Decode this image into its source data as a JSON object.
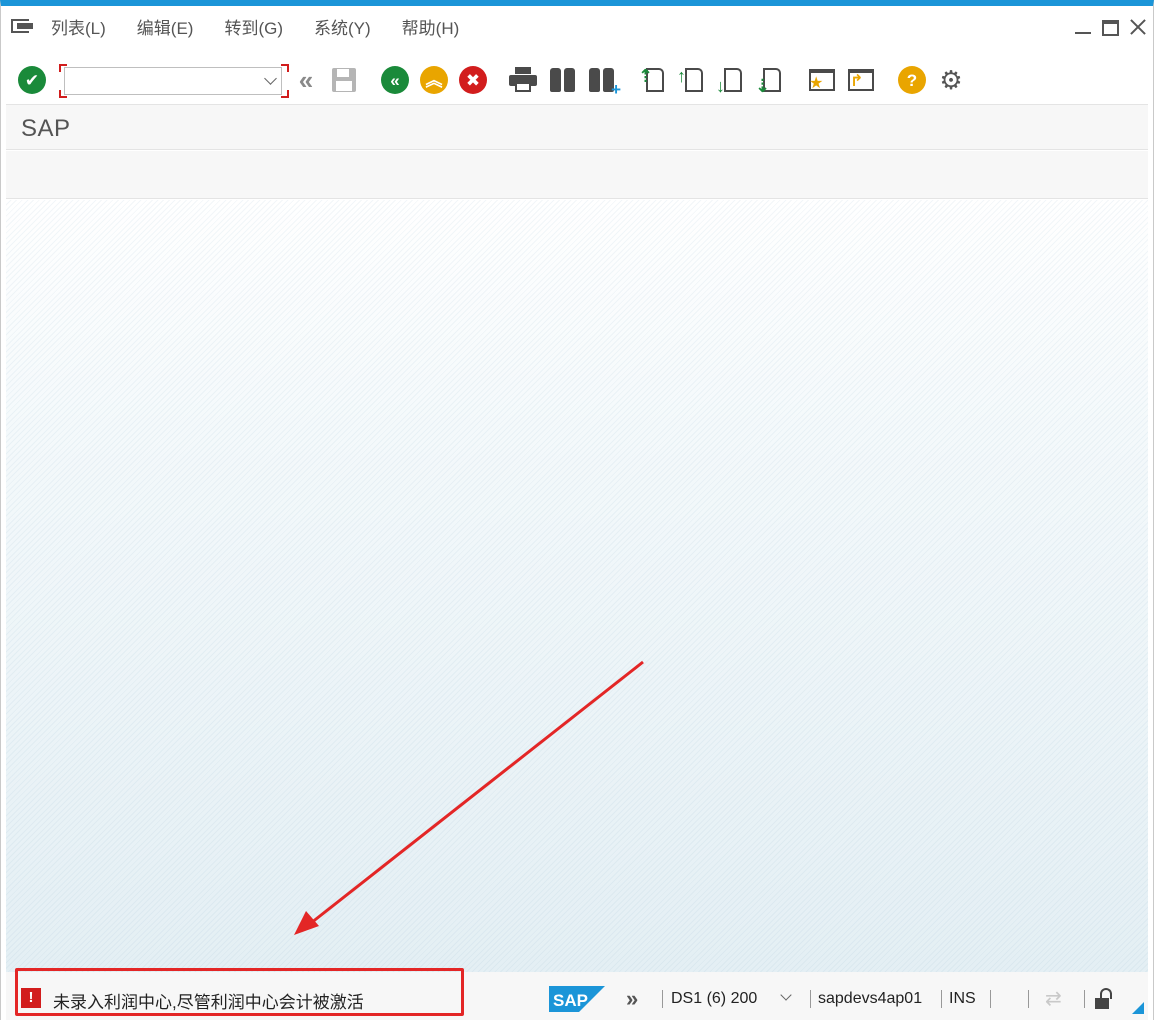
{
  "menubar": {
    "items": [
      "列表(L)",
      "编辑(E)",
      "转到(G)",
      "系统(Y)",
      "帮助(H)"
    ]
  },
  "toolbar": {
    "command_field": {
      "value": "",
      "placeholder": ""
    }
  },
  "title": "SAP",
  "status": {
    "type": "error",
    "error_symbol": "!",
    "message": "未录入利润中心,尽管利润中心会计被激活",
    "system_more": "»",
    "system": "DS1 (6) 200",
    "server": "sapdevs4ap01",
    "mode": "INS"
  },
  "colors": {
    "accent": "#1b95d8",
    "error": "#d21d1d",
    "annotation": "#e32626",
    "ok_green": "#1a8a3a",
    "up_yellow": "#e9a500"
  },
  "icons": {
    "toolbar": [
      "enter-check-icon",
      "back-double-chevron-icon",
      "save-icon",
      "back-icon",
      "exit-icon",
      "cancel-icon",
      "print-icon",
      "find-icon",
      "find-next-icon",
      "first-page-icon",
      "previous-page-icon",
      "next-page-icon",
      "last-page-icon",
      "create-session-icon",
      "generate-shortcut-icon",
      "help-icon",
      "customize-layout-icon"
    ]
  }
}
